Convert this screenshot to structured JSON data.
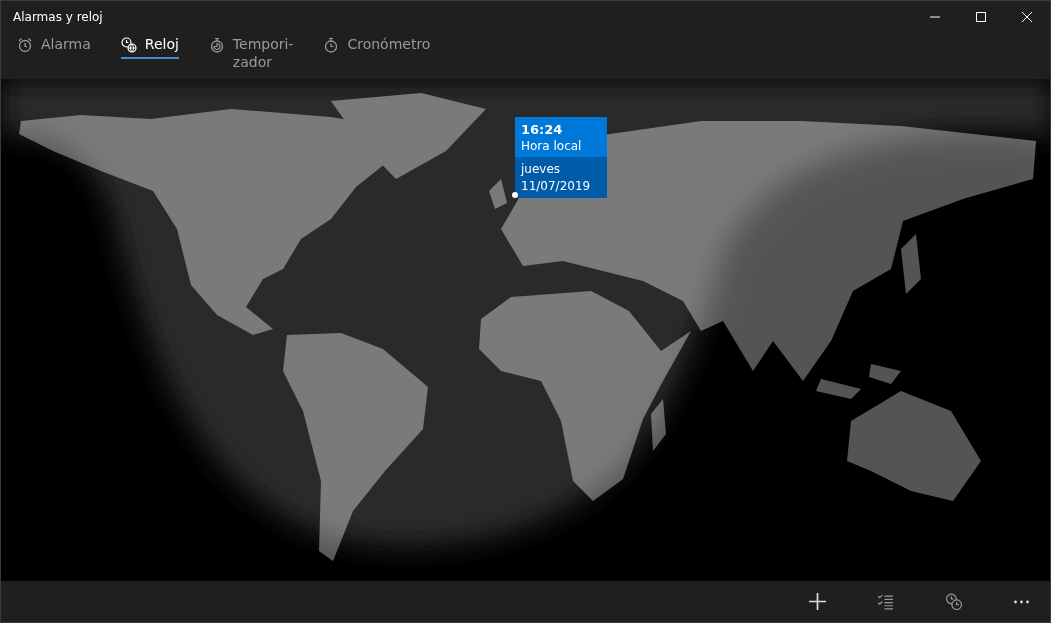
{
  "window": {
    "title": "Alarmas y reloj",
    "controls": [
      {
        "kind": "minimize"
      },
      {
        "kind": "maximize"
      },
      {
        "kind": "close"
      }
    ]
  },
  "tabs": [
    {
      "label": "Alarma",
      "kind": "alarm",
      "selected": false
    },
    {
      "label": "Reloj",
      "kind": "world",
      "selected": true
    },
    {
      "label": "Tempori- zador",
      "kind": "timer",
      "selected": false
    },
    {
      "label": "Cronómetro",
      "kind": "stopwatch",
      "selected": false
    }
  ],
  "map": {
    "kind": "picture",
    "location": {
      "time": "16:24",
      "label": "Hora local",
      "day": "jueves",
      "date": "11/07/2019"
    }
  },
  "toolbar": [
    {
      "kind": "add"
    },
    {
      "kind": "select"
    },
    {
      "kind": "compare"
    },
    {
      "kind": "more"
    }
  ]
}
